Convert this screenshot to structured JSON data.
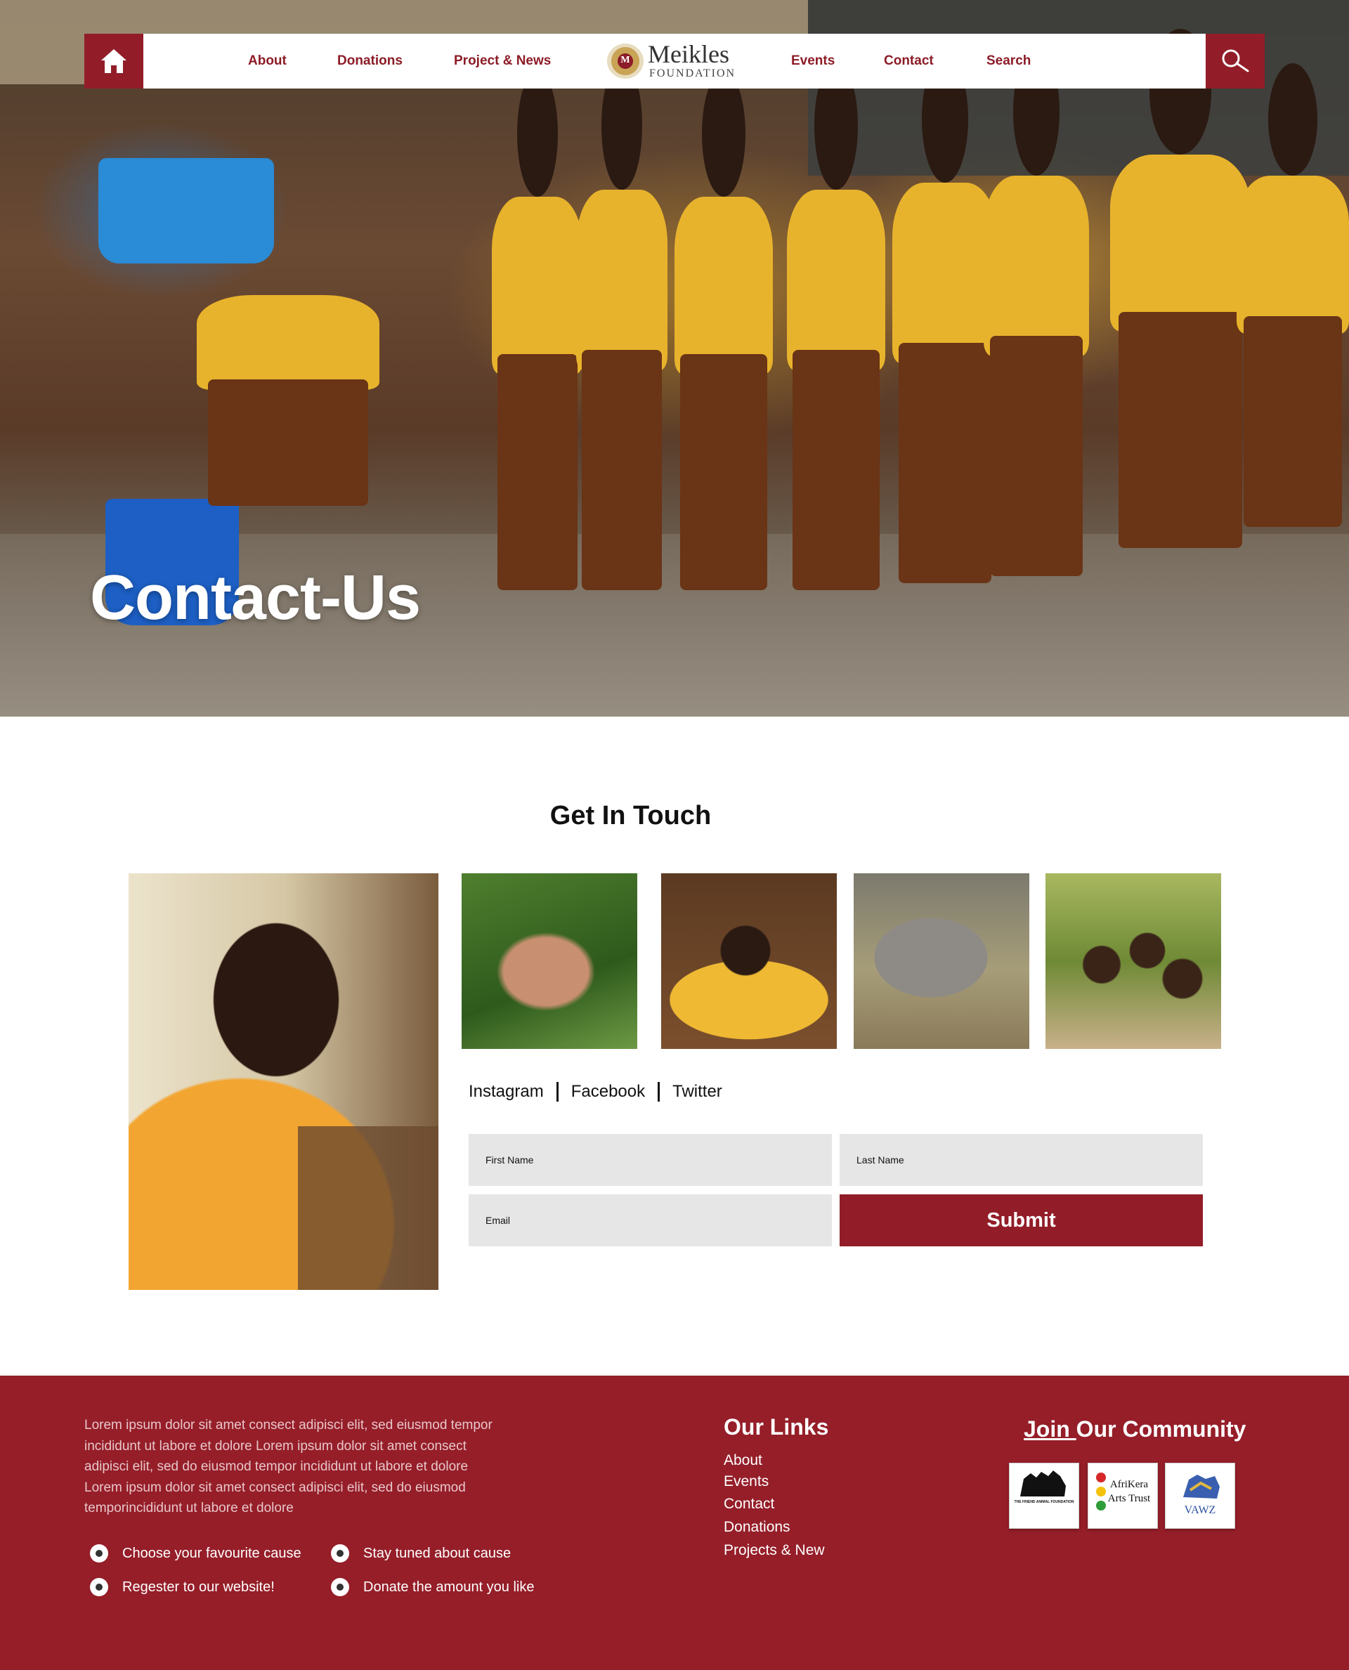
{
  "nav": {
    "links": [
      "About",
      "Donations",
      "Project & News",
      "Events",
      "Contact",
      "Search"
    ],
    "logo_name": "Meikles",
    "logo_sub": "FOUNDATION",
    "logo_crest_letter": "M"
  },
  "hero": {
    "title": "Contact-Us"
  },
  "get_in_touch": {
    "title": "Get In Touch",
    "socials": [
      "Instagram",
      "Facebook",
      "Twitter"
    ],
    "form": {
      "first_name_placeholder": "First Name",
      "last_name_placeholder": "Last Name",
      "email_placeholder": "Email",
      "submit_label": "Submit"
    }
  },
  "footer": {
    "about_text": "Lorem ipsum dolor sit amet consect adipisci elit, sed eiusmod tempor incididunt ut labore et dolore Lorem ipsum dolor sit amet consect adipisci elit,   sed do eiusmod tempor incididunt ut labore et dolore Lorem ipsum dolor sit amet consect adipisci elit, sed do eiusmod temporincididunt ut labore et dolore",
    "bullets": [
      "Choose your favourite cause",
      "Stay tuned about cause",
      "Regester to our website!",
      "Donate the amount you like"
    ],
    "links_title": "Our Links",
    "links": [
      "About",
      "Events",
      "Contact",
      "Donations",
      "Projects & New"
    ],
    "community_title_join": "Join ",
    "community_title_rest": "Our Community",
    "partners": [
      {
        "name": "THE FRIEND ANIMAL FOUNDATION"
      },
      {
        "name": "AfriKera Arts Trust"
      },
      {
        "name": "VAWZ"
      }
    ]
  },
  "colors": {
    "brand": "#921d28",
    "footer_bg": "#951e29",
    "field_bg": "#e6e6e6"
  },
  "icons": {
    "home": "home-icon",
    "search": "search-icon",
    "bullet": "radio-dot-icon"
  }
}
